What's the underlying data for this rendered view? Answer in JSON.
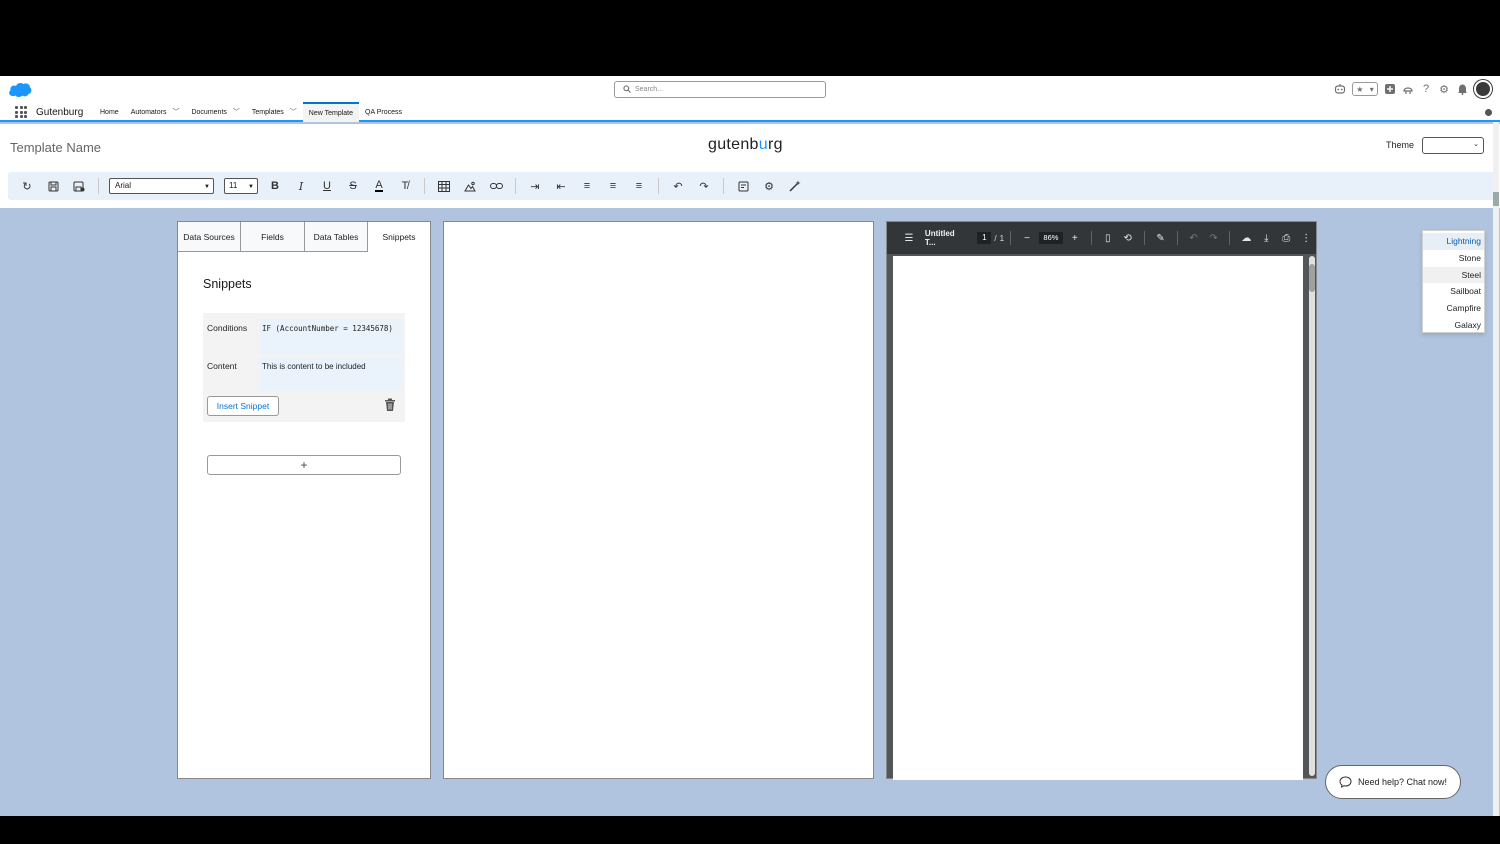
{
  "header": {
    "search_placeholder": "Search..."
  },
  "nav": {
    "app_name": "Gutenburg",
    "items": [
      {
        "label": "Home"
      },
      {
        "label": "Automators"
      },
      {
        "label": "Documents"
      },
      {
        "label": "Templates"
      },
      {
        "label": "New Template"
      },
      {
        "label": "QA Process"
      }
    ]
  },
  "template": {
    "name_placeholder": "Template Name",
    "logo_prefix": "gutenb",
    "logo_accent": "u",
    "logo_suffix": "rg",
    "logo_accent_color": "#1b96ff",
    "theme_label": "Theme",
    "theme_value": ""
  },
  "toolbar": {
    "font_family": "Arial",
    "font_size": "11"
  },
  "theme_dropdown": {
    "options": [
      "Lightning",
      "Stone",
      "Steel",
      "Sailboat",
      "Campfire",
      "Galaxy"
    ],
    "highlighted": "Lightning"
  },
  "left_panel": {
    "tabs": [
      {
        "label": "Data Sources"
      },
      {
        "label": "Fields"
      },
      {
        "label": "Data Tables"
      },
      {
        "label": "Snippets"
      }
    ],
    "active_tab": "Snippets",
    "title": "Snippets",
    "snippet": {
      "conditions_label": "Conditions",
      "conditions_value": "IF (AccountNumber = 12345678)",
      "content_label": "Content",
      "content_value": "This is content to be included",
      "insert_label": "Insert Snippet"
    },
    "add_label": "+"
  },
  "pdf": {
    "title": "Untitled T...",
    "page_current": "1",
    "page_separator": "/",
    "page_total": "1",
    "zoom": "86%"
  },
  "chat": {
    "label": "Need help? Chat now!"
  },
  "colors": {
    "background": "#b0c4df",
    "accent": "#0176d3",
    "pdf_toolbar": "#323639"
  }
}
